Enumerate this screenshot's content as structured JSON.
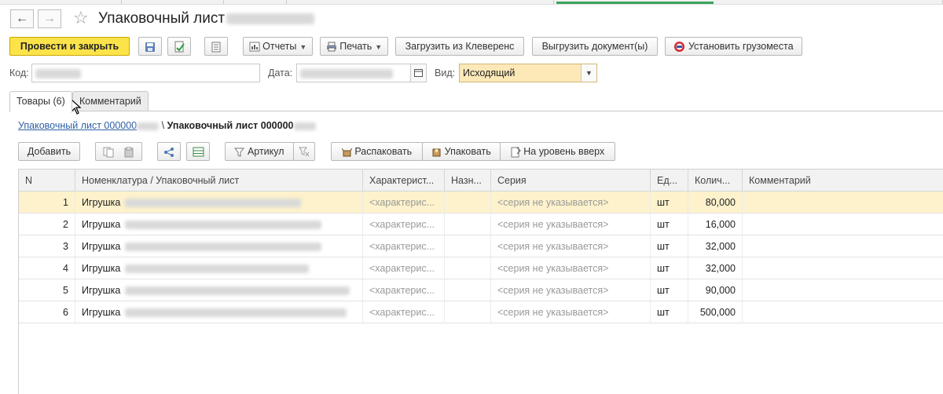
{
  "window": {
    "title": "Упаковочный лист"
  },
  "toolbar": {
    "post_close": "Провести и закрыть",
    "reports": "Отчеты",
    "print": "Печать",
    "load_from": "Загрузить из Клеверенс",
    "export_docs": "Выгрузить документ(ы)",
    "set_cargo": "Установить грузоместа"
  },
  "header": {
    "code_label": "Код:",
    "date_label": "Дата:",
    "kind_label": "Вид:",
    "kind_value": "Исходящий"
  },
  "tabs": [
    {
      "label": "Товары (6)",
      "active": true
    },
    {
      "label": "Комментарий",
      "active": false
    }
  ],
  "breadcrumb": {
    "parent": "Упаковочный лист 000000",
    "separator": "\\",
    "current": "Упаковочный лист 000000"
  },
  "table_toolbar": {
    "add": "Добавить",
    "article": "Артикул",
    "unpack": "Распаковать",
    "pack": "Упаковать",
    "level_up": "На уровень вверх"
  },
  "table": {
    "columns": [
      "N",
      "Номенклатура / Упаковочный лист",
      "Характерист...",
      "Назн...",
      "Серия",
      "Ед...",
      "Колич...",
      "Комментарий"
    ],
    "rows": [
      {
        "n": "1",
        "item": "Игрушка",
        "char": "<характерис...",
        "purpose": "",
        "series": "<серия не указывается>",
        "unit": "шт",
        "qty": "80,000",
        "comment": ""
      },
      {
        "n": "2",
        "item": "Игрушка",
        "char": "<характерис...",
        "purpose": "",
        "series": "<серия не указывается>",
        "unit": "шт",
        "qty": "16,000",
        "comment": ""
      },
      {
        "n": "3",
        "item": "Игрушка",
        "char": "<характерис...",
        "purpose": "",
        "series": "<серия не указывается>",
        "unit": "шт",
        "qty": "32,000",
        "comment": ""
      },
      {
        "n": "4",
        "item": "Игрушка",
        "char": "<характерис...",
        "purpose": "",
        "series": "<серия не указывается>",
        "unit": "шт",
        "qty": "32,000",
        "comment": ""
      },
      {
        "n": "5",
        "item": "Игрушка",
        "char": "<характерис...",
        "purpose": "",
        "series": "<серия не указывается>",
        "unit": "шт",
        "qty": "90,000",
        "comment": ""
      },
      {
        "n": "6",
        "item": "Игрушка",
        "char": "<характерис...",
        "purpose": "",
        "series": "<серия не указывается>",
        "unit": "шт",
        "qty": "500,000",
        "comment": ""
      }
    ],
    "selected_row": 1
  },
  "colors": {
    "primary_button": "#fde34a",
    "selected_field": "#fde8b8",
    "selected_row": "#fdf2cc",
    "link": "#2f5fa6"
  }
}
